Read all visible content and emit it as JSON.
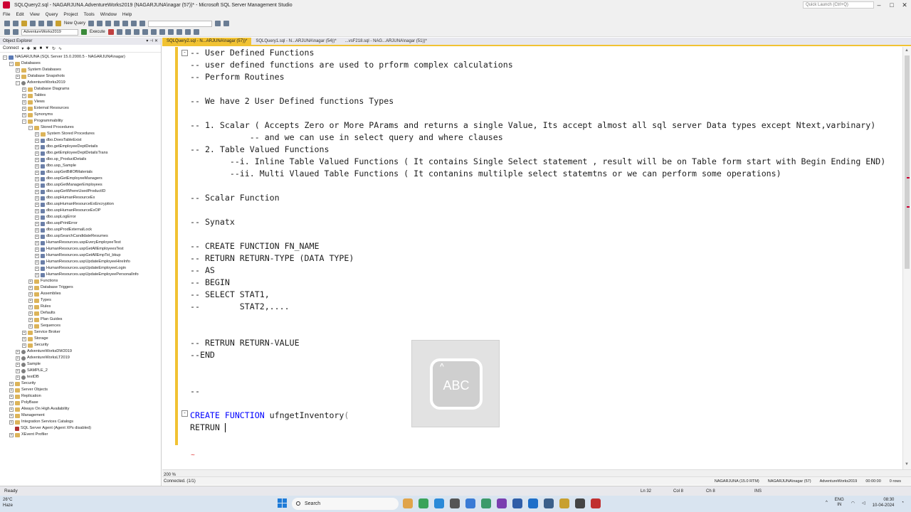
{
  "window": {
    "title": "SQLQuery2.sql - NAGARJUNA.AdventureWorks2019 (NAGARJUNA\\nagar (57))* - Microsoft SQL Server Management Studio",
    "quick_launch": "Quick Launch (Ctrl+Q)"
  },
  "menu": [
    "File",
    "Edit",
    "View",
    "Query",
    "Project",
    "Tools",
    "Window",
    "Help"
  ],
  "toolbar": {
    "new_query": "New Query",
    "database": "AdventureWorks2019",
    "execute": "Execute"
  },
  "object_explorer": {
    "title": "Object Explorer",
    "connect": "Connect",
    "nodes": [
      {
        "label": "NAGARJUNA (SQL Server 15.0.2000.5 - NAGARJUNA\\nagar)",
        "level": 0,
        "exp": "-",
        "icon": "srv"
      },
      {
        "label": "Databases",
        "level": 1,
        "exp": "-",
        "icon": "folder"
      },
      {
        "label": "System Databases",
        "level": 2,
        "exp": "+",
        "icon": "folder"
      },
      {
        "label": "Database Snapshots",
        "level": 2,
        "exp": "+",
        "icon": "folder"
      },
      {
        "label": "AdventureWorks2019",
        "level": 2,
        "exp": "-",
        "icon": "db"
      },
      {
        "label": "Database Diagrams",
        "level": 3,
        "exp": "+",
        "icon": "folder"
      },
      {
        "label": "Tables",
        "level": 3,
        "exp": "+",
        "icon": "folder"
      },
      {
        "label": "Views",
        "level": 3,
        "exp": "+",
        "icon": "folder"
      },
      {
        "label": "External Resources",
        "level": 3,
        "exp": "+",
        "icon": "folder"
      },
      {
        "label": "Synonyms",
        "level": 3,
        "exp": "+",
        "icon": "folder"
      },
      {
        "label": "Programmability",
        "level": 3,
        "exp": "-",
        "icon": "folder"
      },
      {
        "label": "Stored Procedures",
        "level": 4,
        "exp": "-",
        "icon": "folder"
      },
      {
        "label": "System Stored Procedures",
        "level": 5,
        "exp": "+",
        "icon": "folder"
      },
      {
        "label": "dbo.DoesTableExist",
        "level": 5,
        "exp": "+",
        "icon": "sp"
      },
      {
        "label": "dbo.getEmployeeDeptDetails",
        "level": 5,
        "exp": "+",
        "icon": "sp"
      },
      {
        "label": "dbo.getEmployeeDeptDetailsTrans",
        "level": 5,
        "exp": "+",
        "icon": "sp"
      },
      {
        "label": "dbo.sp_ProductDetails",
        "level": 5,
        "exp": "+",
        "icon": "sp"
      },
      {
        "label": "dbo.usp_Sample",
        "level": 5,
        "exp": "+",
        "icon": "sp"
      },
      {
        "label": "dbo.uspGetBillOfMaterials",
        "level": 5,
        "exp": "+",
        "icon": "sp"
      },
      {
        "label": "dbo.uspGetEmployeeManagers",
        "level": 5,
        "exp": "+",
        "icon": "sp"
      },
      {
        "label": "dbo.uspGetManagerEmployees",
        "level": 5,
        "exp": "+",
        "icon": "sp"
      },
      {
        "label": "dbo.uspGetWhereUsedProductID",
        "level": 5,
        "exp": "+",
        "icon": "sp"
      },
      {
        "label": "dbo.uspHumanResourceEx",
        "level": 5,
        "exp": "+",
        "icon": "sp"
      },
      {
        "label": "dbo.uspHumanResourceExEncryption",
        "level": 5,
        "exp": "+",
        "icon": "sp"
      },
      {
        "label": "dbo.uspHumanResourceExOP",
        "level": 5,
        "exp": "+",
        "icon": "sp"
      },
      {
        "label": "dbo.uspLogError",
        "level": 5,
        "exp": "+",
        "icon": "sp"
      },
      {
        "label": "dbo.uspPrintError",
        "level": 5,
        "exp": "+",
        "icon": "sp"
      },
      {
        "label": "dbo.uspProdExternalLock",
        "level": 5,
        "exp": "+",
        "icon": "sp"
      },
      {
        "label": "dbo.uspSearchCandidateResumes",
        "level": 5,
        "exp": "+",
        "icon": "sp"
      },
      {
        "label": "HumanResources.uspEveryEmployeeTest",
        "level": 5,
        "exp": "+",
        "icon": "sp"
      },
      {
        "label": "HumanResources.uspGetAllEmployeesTest",
        "level": 5,
        "exp": "+",
        "icon": "sp"
      },
      {
        "label": "HumanResources.uspGetAllEmpTst_bkup",
        "level": 5,
        "exp": "+",
        "icon": "sp"
      },
      {
        "label": "HumanResources.uspUpdateEmployeeHireInfo",
        "level": 5,
        "exp": "+",
        "icon": "sp"
      },
      {
        "label": "HumanResources.uspUpdateEmployeeLogin",
        "level": 5,
        "exp": "+",
        "icon": "sp"
      },
      {
        "label": "HumanResources.uspUpdateEmployeePersonalInfo",
        "level": 5,
        "exp": "+",
        "icon": "sp"
      },
      {
        "label": "Functions",
        "level": 4,
        "exp": "+",
        "icon": "folder"
      },
      {
        "label": "Database Triggers",
        "level": 4,
        "exp": "+",
        "icon": "folder"
      },
      {
        "label": "Assemblies",
        "level": 4,
        "exp": "+",
        "icon": "folder"
      },
      {
        "label": "Types",
        "level": 4,
        "exp": "+",
        "icon": "folder"
      },
      {
        "label": "Rules",
        "level": 4,
        "exp": "+",
        "icon": "folder"
      },
      {
        "label": "Defaults",
        "level": 4,
        "exp": "+",
        "icon": "folder"
      },
      {
        "label": "Plan Guides",
        "level": 4,
        "exp": "+",
        "icon": "folder"
      },
      {
        "label": "Sequences",
        "level": 4,
        "exp": "+",
        "icon": "folder"
      },
      {
        "label": "Service Broker",
        "level": 3,
        "exp": "+",
        "icon": "folder"
      },
      {
        "label": "Storage",
        "level": 3,
        "exp": "+",
        "icon": "folder"
      },
      {
        "label": "Security",
        "level": 3,
        "exp": "+",
        "icon": "folder"
      },
      {
        "label": "AdventureWorksDW2019",
        "level": 2,
        "exp": "+",
        "icon": "db"
      },
      {
        "label": "AdventureWorksLT2019",
        "level": 2,
        "exp": "+",
        "icon": "db"
      },
      {
        "label": "Sample",
        "level": 2,
        "exp": "+",
        "icon": "db"
      },
      {
        "label": "SAMPLE_2",
        "level": 2,
        "exp": "+",
        "icon": "db"
      },
      {
        "label": "testDB",
        "level": 2,
        "exp": "+",
        "icon": "db"
      },
      {
        "label": "Security",
        "level": 1,
        "exp": "+",
        "icon": "folder"
      },
      {
        "label": "Server Objects",
        "level": 1,
        "exp": "+",
        "icon": "folder"
      },
      {
        "label": "Replication",
        "level": 1,
        "exp": "+",
        "icon": "folder"
      },
      {
        "label": "PolyBase",
        "level": 1,
        "exp": "+",
        "icon": "folder"
      },
      {
        "label": "Always On High Availability",
        "level": 1,
        "exp": "+",
        "icon": "folder"
      },
      {
        "label": "Management",
        "level": 1,
        "exp": "+",
        "icon": "folder"
      },
      {
        "label": "Integration Services Catalogs",
        "level": 1,
        "exp": "+",
        "icon": "folder"
      },
      {
        "label": "SQL Server Agent (Agent XPs disabled)",
        "level": 1,
        "exp": "",
        "icon": "agent"
      },
      {
        "label": "XEvent Profiler",
        "level": 1,
        "exp": "+",
        "icon": "folder"
      }
    ]
  },
  "tabs": [
    {
      "label": "SQLQuery2.sql - N...ARJUNA\\nagar (57))*",
      "active": true
    },
    {
      "label": "SQLQuery1.sql - N...ARJUNA\\nagar (54))*",
      "active": false
    },
    {
      "label": "...vsF218.sql - NAG...ARJUNA\\nagar (51))*",
      "active": false
    }
  ],
  "editor": {
    "lines": [
      "-- User Defined Functions",
      "-- user defined functions are used to prform complex calculations",
      "-- Perform Routines",
      "",
      "-- We have 2 User Defined functions Types",
      "",
      "-- 1. Scalar ( Accepts Zero or More PArams and returns a single Value, Its accept almost all sql server Data types except Ntext,varbinary)",
      "            -- and we can use in select query and where clauses",
      "-- 2. Table Valued Functions",
      "        --i. Inline Table Valued Functions ( It contains Single Select statement , result will be on Table form start with Begin Ending END)",
      "        --ii. Multi Vlaued Table Functions ( It contanins multilple select statemtns or we can perform some operations)",
      "",
      "-- Scalar Function",
      "",
      "-- Synatx",
      "",
      "-- CREATE FUNCTION FN_NAME",
      "-- RETURN RETURN-TYPE (DATA TYPE)",
      "-- AS",
      "-- BEGIN",
      "-- SELECT STAT1,",
      "--        STAT2,....",
      "",
      "",
      "-- RETRUN RETURN-VALUE",
      "--END",
      "",
      "",
      "--",
      "",
      "CREATE FUNCTION ufngetInventory(",
      "RETRUN "
    ],
    "create_kw": "CREATE FUNCTION",
    "fn_name": " ufngetInventory",
    "paren": "(",
    "last_line": "RETRUN ",
    "squiggle": "~"
  },
  "zoom": "200 %",
  "connection": {
    "status": "Connected. (1/1)",
    "server": "NAGARJUNA (15.0 RTM)",
    "user": "NAGARJUNA\\nagar (57)",
    "database": "AdventureWorks2019",
    "time": "00:00:00",
    "rows": "0 rows"
  },
  "status": {
    "ready": "Ready",
    "ln": "Ln 32",
    "col": "Col 8",
    "ch": "Ch 8",
    "ins": "INS"
  },
  "osk": {
    "label": "ABC"
  },
  "taskbar": {
    "temp": "26°C",
    "weather": "Haze",
    "search": "Search",
    "lang1": "ENG",
    "lang2": "IN",
    "time": "08:30",
    "date": "10-04-2024"
  },
  "colors": {
    "accent_tab": "#f1c232",
    "keyword": "#0000ff"
  }
}
